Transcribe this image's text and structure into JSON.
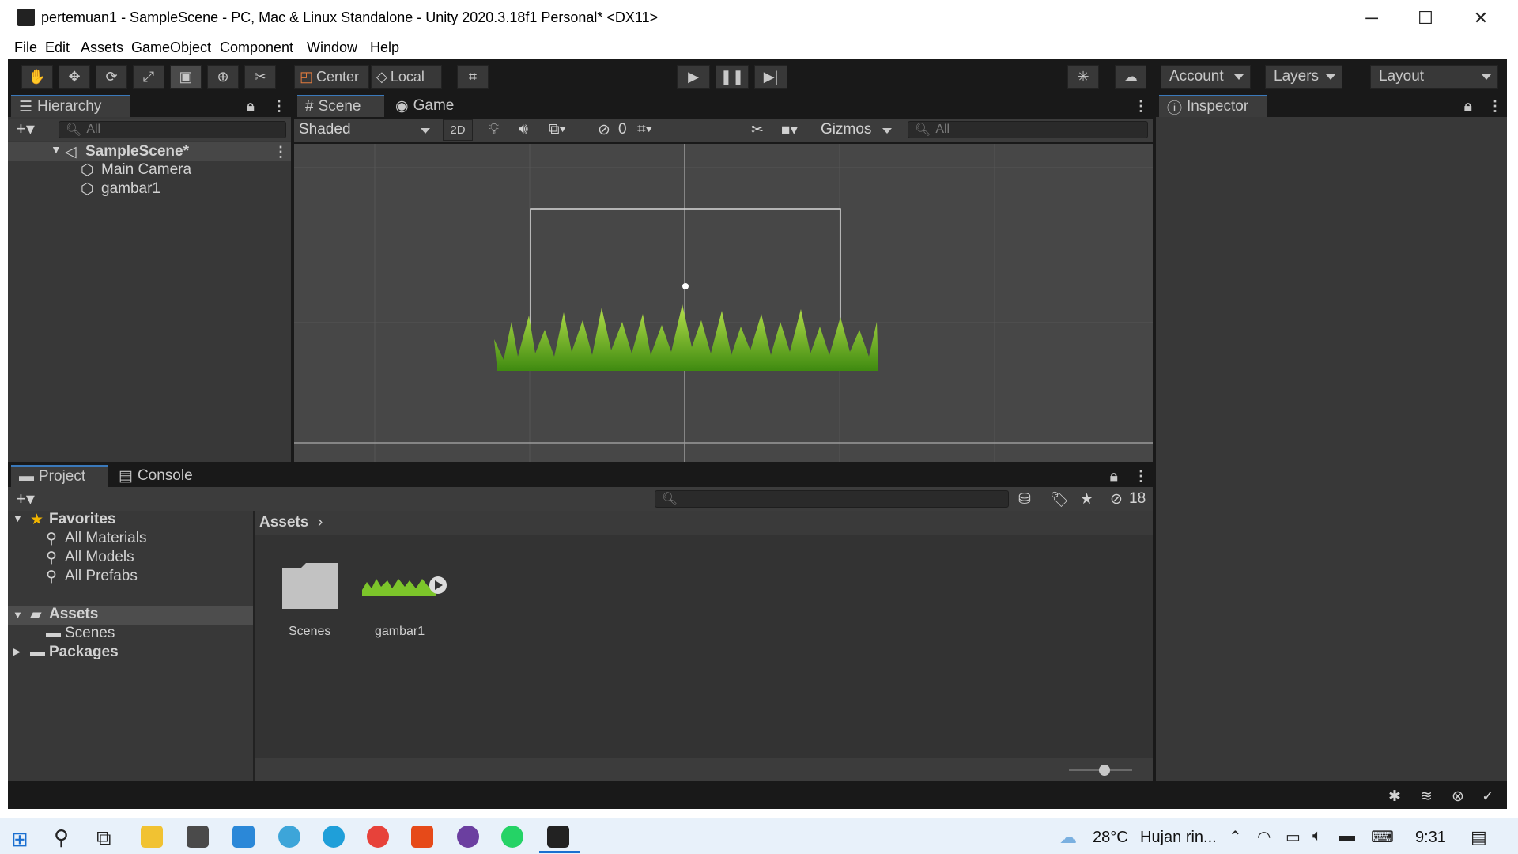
{
  "window": {
    "title": "pertemuan1 - SampleScene - PC, Mac & Linux Standalone - Unity 2020.3.18f1 Personal* <DX11>",
    "controls": {
      "minimize": "─",
      "maximize": "☐",
      "close": "✕"
    }
  },
  "menubar": [
    "File",
    "Edit",
    "Assets",
    "GameObject",
    "Component",
    "Window",
    "Help"
  ],
  "toolbar": {
    "pivot": "Center",
    "space": "Local",
    "account": "Account",
    "layers": "Layers",
    "layout": "Layout"
  },
  "hierarchy": {
    "tab": "Hierarchy",
    "search_placeholder": "All",
    "scene": "SampleScene*",
    "items": [
      "Main Camera",
      "gambar1"
    ]
  },
  "scene": {
    "tabs": [
      "Scene",
      "Game"
    ],
    "shading": "Shaded",
    "mode_2d": "2D",
    "hidden_count": "0",
    "gizmos": "Gizmos",
    "search_placeholder": "All"
  },
  "inspector": {
    "tab": "Inspector"
  },
  "project": {
    "tabs": [
      "Project",
      "Console"
    ],
    "hidden_count": "18",
    "favorites": {
      "label": "Favorites",
      "items": [
        "All Materials",
        "All Models",
        "All Prefabs"
      ]
    },
    "tree": {
      "assets": "Assets",
      "scenes": "Scenes",
      "packages": "Packages"
    },
    "breadcrumb": "Assets",
    "assets": [
      {
        "name": "Scenes",
        "type": "folder"
      },
      {
        "name": "gambar1",
        "type": "sprite"
      }
    ]
  },
  "taskbar": {
    "weather_temp": "28°C",
    "weather_text": "Hujan rin...",
    "time": "9:31"
  },
  "colors": {
    "editor_bg": "#191919",
    "panel_bg": "#383838",
    "active_tab_accent": "#3a79bb",
    "grass": "#7cc52a"
  }
}
